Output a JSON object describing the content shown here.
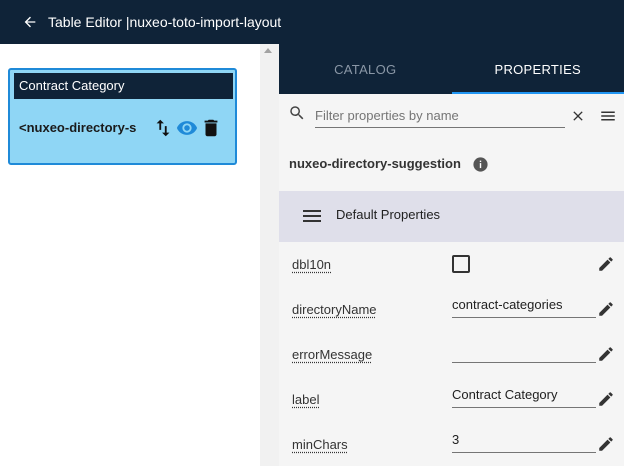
{
  "window": {
    "title": "Table Editor |nuxeo-toto-import-layout"
  },
  "card": {
    "header": "Contract Category",
    "element": "<nuxeo-directory-s"
  },
  "tabs": [
    {
      "label": "CATALOG",
      "active": false
    },
    {
      "label": "PROPERTIES",
      "active": true
    }
  ],
  "filter": {
    "placeholder": "Filter properties by name",
    "value": ""
  },
  "element_name": "nuxeo-directory-suggestion",
  "section": {
    "label": "Default Properties"
  },
  "properties": [
    {
      "name": "dbl10n",
      "type": "checkbox",
      "value": ""
    },
    {
      "name": "directoryName",
      "type": "text",
      "value": "contract-categories"
    },
    {
      "name": "errorMessage",
      "type": "text",
      "value": ""
    },
    {
      "name": "label",
      "type": "text",
      "value": "Contract Category"
    },
    {
      "name": "minChars",
      "type": "text",
      "value": "3"
    }
  ],
  "colors": {
    "topbar": "#0f2338",
    "card_bg": "#8fd6f5",
    "card_border": "#1f8ad8",
    "eye_icon": "#1f8ad8",
    "tab_indicator": "#2196f3",
    "section_bg": "#dfdfea"
  }
}
